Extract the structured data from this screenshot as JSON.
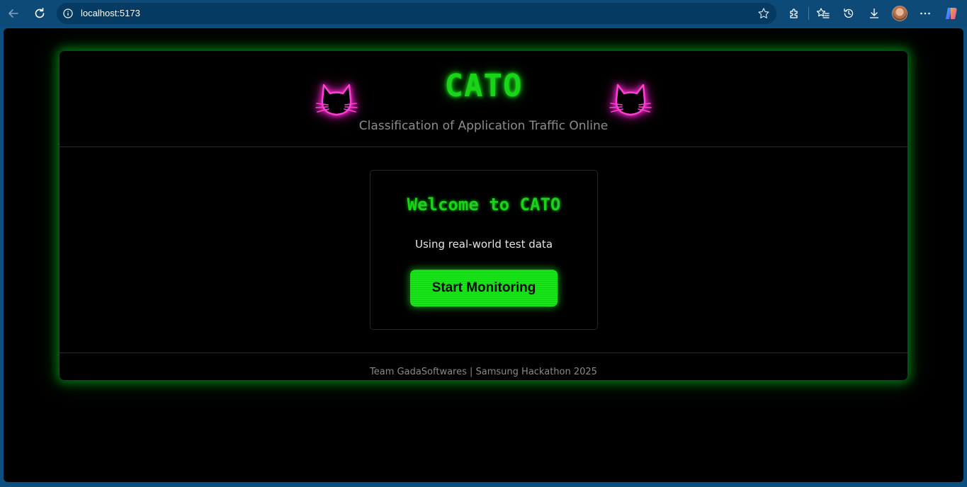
{
  "browser": {
    "url": "localhost:5173",
    "icons": {
      "back": "back-arrow-icon",
      "refresh": "refresh-icon",
      "info": "site-info-icon",
      "favorite": "star-icon",
      "extensions": "puzzle-icon",
      "favorites": "favorites-icon",
      "history": "history-icon",
      "downloads": "download-icon",
      "more": "more-icon",
      "copilot": "copilot-icon"
    }
  },
  "app": {
    "title": "CATO",
    "subtitle": "Classification of Application Traffic Online",
    "welcome": {
      "title": "Welcome to CATO",
      "text": "Using real-world test data",
      "button": "Start Monitoring"
    },
    "footer": "Team GadaSoftwares | Samsung Hackathon 2025",
    "colors": {
      "accent_green": "#19d419",
      "cat_pink": "#ff2fd0",
      "background": "#000000"
    }
  }
}
